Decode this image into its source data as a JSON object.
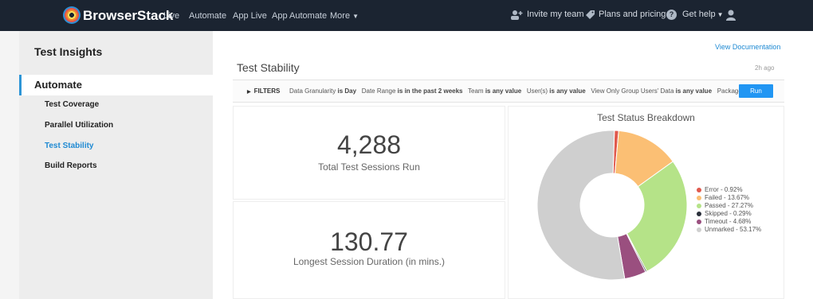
{
  "header": {
    "brand": "BrowserStack",
    "nav": [
      {
        "label": "Live"
      },
      {
        "label": "Automate"
      },
      {
        "label": "App Live"
      },
      {
        "label": "App Automate"
      },
      {
        "label": "More"
      }
    ],
    "invite": "Invite my team",
    "plans": "Plans and pricing",
    "help": "Get help",
    "icons": [
      "invite-team-icon",
      "plans-tag-icon",
      "help-icon",
      "user-icon"
    ]
  },
  "sidebar": {
    "title": "Test Insights",
    "section": "Automate",
    "items": [
      {
        "label": "Test Coverage",
        "active": false
      },
      {
        "label": "Parallel Utilization",
        "active": false
      },
      {
        "label": "Test Stability",
        "active": true
      },
      {
        "label": "Build Reports",
        "active": false
      }
    ]
  },
  "main": {
    "view_doc": "View Documentation",
    "title": "Test Stability",
    "ago": "2h ago",
    "filters_label": "FILTERS",
    "filters": [
      {
        "key": "Data Granularity",
        "value": "is Day"
      },
      {
        "key": "Date Range",
        "value": "is in the past 2 weeks"
      },
      {
        "key": "Team",
        "value": "is any value"
      },
      {
        "key": "User(s)",
        "value": "is any value"
      },
      {
        "key": "View Only Group Users' Data",
        "value": "is any value"
      },
      {
        "key": "Package Nam",
        "value": ""
      }
    ],
    "run": "Run",
    "kpi1": {
      "value": "4,288",
      "label": "Total Test Sessions Run"
    },
    "kpi2": {
      "value": "130.77",
      "label": "Longest Session Duration (in mins.)"
    }
  },
  "chart_data": {
    "type": "pie",
    "title": "Test Status Breakdown",
    "slices": [
      {
        "label": "Error - 0.92%",
        "value": 0.92,
        "color": "#e0594d"
      },
      {
        "label": "Failed - 13.67%",
        "value": 13.67,
        "color": "#fbbf74"
      },
      {
        "label": "Passed - 27.27%",
        "value": 27.27,
        "color": "#b5e388"
      },
      {
        "label": "Skipped - 0.29%",
        "value": 0.29,
        "color": "#2a2f3a"
      },
      {
        "label": "Timeout - 4.68%",
        "value": 4.68,
        "color": "#9a4f7f"
      },
      {
        "label": "Unmarked - 53.17%",
        "value": 53.17,
        "color": "#cfcfcf"
      }
    ],
    "donut": true,
    "legend_position": "right"
  }
}
